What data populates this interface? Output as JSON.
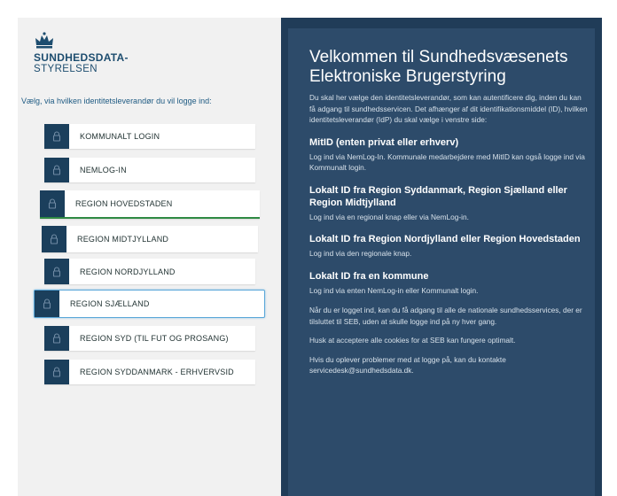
{
  "brand": {
    "line1": "SUNDHEDSDATA-",
    "line2": "STYRELSEN"
  },
  "intro": "Vælg, via hvilken identitetsleverandør du vil logge ind:",
  "buttons": [
    {
      "label": "KOMMUNALT LOGIN",
      "icon": "lock-icon"
    },
    {
      "label": "NEMLOG-IN",
      "icon": "lock-icon"
    },
    {
      "label": "REGION HOVEDSTADEN",
      "icon": "lock-icon"
    },
    {
      "label": "REGION MIDTJYLLAND",
      "icon": "lock-icon"
    },
    {
      "label": "REGION NORDJYLLAND",
      "icon": "lock-icon"
    },
    {
      "label": "REGION SJÆLLAND",
      "icon": "lock-icon"
    },
    {
      "label": "REGION SYD (TIL FUT OG PROSANG)",
      "icon": "lock-icon"
    },
    {
      "label": "REGION SYDDANMARK - ERHVERVSID",
      "icon": "lock-icon"
    }
  ],
  "info": {
    "title": "Velkommen til Sundhedsvæsenets Elektroniske Brugerstyring",
    "intro": "Du skal her vælge den identitetsleverandør, som kan autentificere dig, inden du kan få adgang til sundhedsservicen. Det afhænger af dit identifikationsmiddel (ID), hvilken identitetsleverandør (IdP) du skal vælge i venstre side:",
    "s1_h": "MitID (enten privat eller erhverv)",
    "s1_p": "Log ind via NemLog-In. Kommunale medarbejdere med MitID kan også logge ind via Kommunalt login.",
    "s2_h": "Lokalt ID fra Region Syddanmark, Region Sjælland eller Region Midtjylland",
    "s2_p": "Log ind via en regional knap eller via NemLog-in.",
    "s3_h": "Lokalt ID fra Region Nordjylland eller Region Hovedstaden",
    "s3_p": "Log ind via den regionale knap.",
    "s4_h": "Lokalt ID fra en kommune",
    "s4_p": "Log ind via enten NemLog-in eller Kommunalt login.",
    "p5": "Når du er logget ind, kan du få adgang til alle de nationale sundhedsservices, der er tilsluttet til SEB, uden at skulle logge ind på ny hver gang.",
    "p6": "Husk at acceptere alle cookies for at SEB kan fungere optimalt.",
    "p7": "Hvis du oplever problemer med at logge på, kan du kontakte servicedesk@sundhedsdata.dk."
  },
  "colors": {
    "navy": "#1b3f5c",
    "panel": "#2d4b6a",
    "accent_green": "#2f8a43",
    "focus_blue": "#59a6d8"
  }
}
